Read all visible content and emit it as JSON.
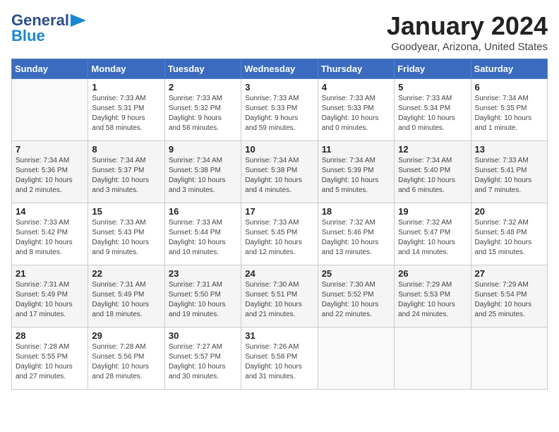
{
  "header": {
    "logo_line1": "General",
    "logo_line2": "Blue",
    "title": "January 2024",
    "subtitle": "Goodyear, Arizona, United States"
  },
  "weekdays": [
    "Sunday",
    "Monday",
    "Tuesday",
    "Wednesday",
    "Thursday",
    "Friday",
    "Saturday"
  ],
  "weeks": [
    [
      {
        "day": "",
        "info": ""
      },
      {
        "day": "1",
        "info": "Sunrise: 7:33 AM\nSunset: 5:31 PM\nDaylight: 9 hours\nand 58 minutes."
      },
      {
        "day": "2",
        "info": "Sunrise: 7:33 AM\nSunset: 5:32 PM\nDaylight: 9 hours\nand 58 minutes."
      },
      {
        "day": "3",
        "info": "Sunrise: 7:33 AM\nSunset: 5:33 PM\nDaylight: 9 hours\nand 59 minutes."
      },
      {
        "day": "4",
        "info": "Sunrise: 7:33 AM\nSunset: 5:33 PM\nDaylight: 10 hours\nand 0 minutes."
      },
      {
        "day": "5",
        "info": "Sunrise: 7:33 AM\nSunset: 5:34 PM\nDaylight: 10 hours\nand 0 minutes."
      },
      {
        "day": "6",
        "info": "Sunrise: 7:34 AM\nSunset: 5:35 PM\nDaylight: 10 hours\nand 1 minute."
      }
    ],
    [
      {
        "day": "7",
        "info": "Sunrise: 7:34 AM\nSunset: 5:36 PM\nDaylight: 10 hours\nand 2 minutes."
      },
      {
        "day": "8",
        "info": "Sunrise: 7:34 AM\nSunset: 5:37 PM\nDaylight: 10 hours\nand 3 minutes."
      },
      {
        "day": "9",
        "info": "Sunrise: 7:34 AM\nSunset: 5:38 PM\nDaylight: 10 hours\nand 3 minutes."
      },
      {
        "day": "10",
        "info": "Sunrise: 7:34 AM\nSunset: 5:38 PM\nDaylight: 10 hours\nand 4 minutes."
      },
      {
        "day": "11",
        "info": "Sunrise: 7:34 AM\nSunset: 5:39 PM\nDaylight: 10 hours\nand 5 minutes."
      },
      {
        "day": "12",
        "info": "Sunrise: 7:34 AM\nSunset: 5:40 PM\nDaylight: 10 hours\nand 6 minutes."
      },
      {
        "day": "13",
        "info": "Sunrise: 7:33 AM\nSunset: 5:41 PM\nDaylight: 10 hours\nand 7 minutes."
      }
    ],
    [
      {
        "day": "14",
        "info": "Sunrise: 7:33 AM\nSunset: 5:42 PM\nDaylight: 10 hours\nand 8 minutes."
      },
      {
        "day": "15",
        "info": "Sunrise: 7:33 AM\nSunset: 5:43 PM\nDaylight: 10 hours\nand 9 minutes."
      },
      {
        "day": "16",
        "info": "Sunrise: 7:33 AM\nSunset: 5:44 PM\nDaylight: 10 hours\nand 10 minutes."
      },
      {
        "day": "17",
        "info": "Sunrise: 7:33 AM\nSunset: 5:45 PM\nDaylight: 10 hours\nand 12 minutes."
      },
      {
        "day": "18",
        "info": "Sunrise: 7:32 AM\nSunset: 5:46 PM\nDaylight: 10 hours\nand 13 minutes."
      },
      {
        "day": "19",
        "info": "Sunrise: 7:32 AM\nSunset: 5:47 PM\nDaylight: 10 hours\nand 14 minutes."
      },
      {
        "day": "20",
        "info": "Sunrise: 7:32 AM\nSunset: 5:48 PM\nDaylight: 10 hours\nand 15 minutes."
      }
    ],
    [
      {
        "day": "21",
        "info": "Sunrise: 7:31 AM\nSunset: 5:49 PM\nDaylight: 10 hours\nand 17 minutes."
      },
      {
        "day": "22",
        "info": "Sunrise: 7:31 AM\nSunset: 5:49 PM\nDaylight: 10 hours\nand 18 minutes."
      },
      {
        "day": "23",
        "info": "Sunrise: 7:31 AM\nSunset: 5:50 PM\nDaylight: 10 hours\nand 19 minutes."
      },
      {
        "day": "24",
        "info": "Sunrise: 7:30 AM\nSunset: 5:51 PM\nDaylight: 10 hours\nand 21 minutes."
      },
      {
        "day": "25",
        "info": "Sunrise: 7:30 AM\nSunset: 5:52 PM\nDaylight: 10 hours\nand 22 minutes."
      },
      {
        "day": "26",
        "info": "Sunrise: 7:29 AM\nSunset: 5:53 PM\nDaylight: 10 hours\nand 24 minutes."
      },
      {
        "day": "27",
        "info": "Sunrise: 7:29 AM\nSunset: 5:54 PM\nDaylight: 10 hours\nand 25 minutes."
      }
    ],
    [
      {
        "day": "28",
        "info": "Sunrise: 7:28 AM\nSunset: 5:55 PM\nDaylight: 10 hours\nand 27 minutes."
      },
      {
        "day": "29",
        "info": "Sunrise: 7:28 AM\nSunset: 5:56 PM\nDaylight: 10 hours\nand 28 minutes."
      },
      {
        "day": "30",
        "info": "Sunrise: 7:27 AM\nSunset: 5:57 PM\nDaylight: 10 hours\nand 30 minutes."
      },
      {
        "day": "31",
        "info": "Sunrise: 7:26 AM\nSunset: 5:58 PM\nDaylight: 10 hours\nand 31 minutes."
      },
      {
        "day": "",
        "info": ""
      },
      {
        "day": "",
        "info": ""
      },
      {
        "day": "",
        "info": ""
      }
    ]
  ]
}
